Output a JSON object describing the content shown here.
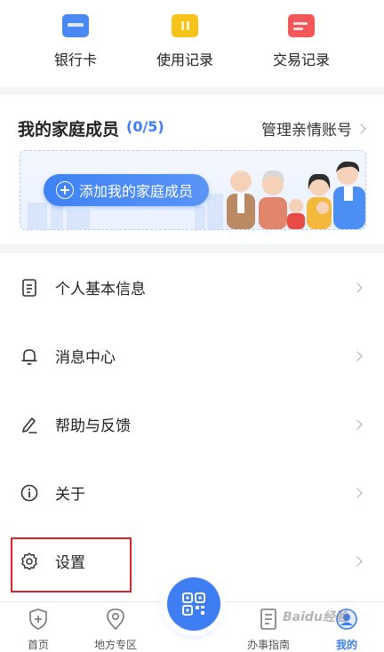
{
  "quick_actions": [
    {
      "label": "银行卡",
      "icon": "bank-card-icon"
    },
    {
      "label": "使用记录",
      "icon": "usage-record-icon"
    },
    {
      "label": "交易记录",
      "icon": "transaction-record-icon"
    }
  ],
  "family": {
    "title": "我的家庭成员",
    "count": "(0/5)",
    "manage_label": "管理亲情账号",
    "add_button": "添加我的家庭成员"
  },
  "menu": [
    {
      "label": "个人基本信息",
      "icon": "document-icon"
    },
    {
      "label": "消息中心",
      "icon": "bell-icon"
    },
    {
      "label": "帮助与反馈",
      "icon": "pen-icon"
    },
    {
      "label": "关于",
      "icon": "info-icon"
    },
    {
      "label": "设置",
      "icon": "gear-icon"
    }
  ],
  "bottom_nav": [
    {
      "label": "首页",
      "icon": "shield-plus-icon",
      "active": false
    },
    {
      "label": "地方专区",
      "icon": "location-pin-icon",
      "active": false
    },
    {
      "label": "办事指南",
      "icon": "guide-document-icon",
      "active": false
    },
    {
      "label": "我的",
      "icon": "profile-avatar-icon",
      "active": true
    }
  ],
  "colors": {
    "accent": "#3d7ef2",
    "highlight_box": "#d9252a",
    "background": "#f4f5f7"
  },
  "watermark": "Baidu经验"
}
